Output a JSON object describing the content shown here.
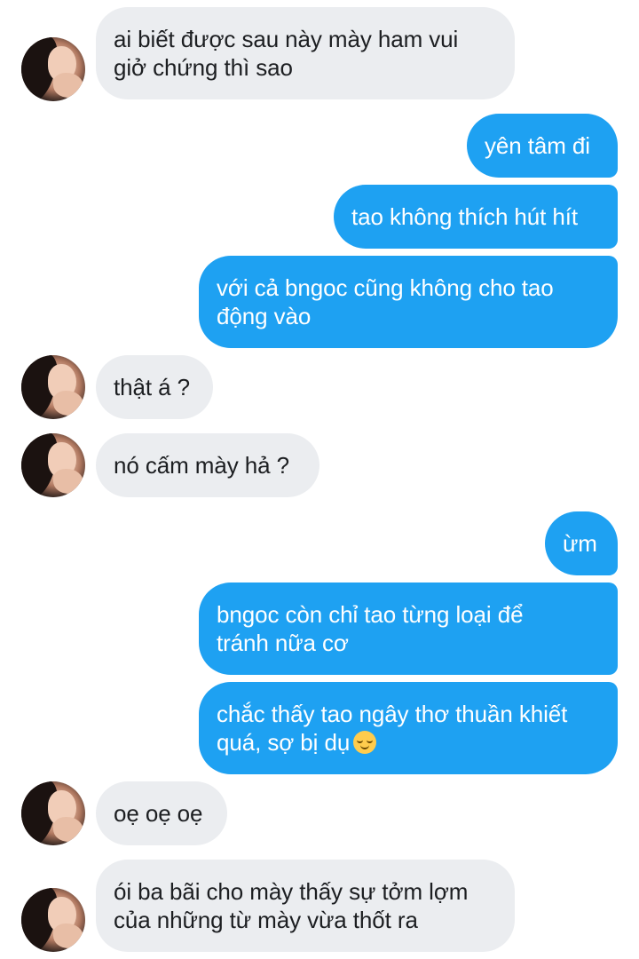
{
  "messages": [
    {
      "side": "in",
      "lines": [
        "ai biết được sau này mày ham vui",
        "giở chứng thì sao"
      ]
    },
    {
      "side": "out",
      "lines": [
        "yên tâm đi"
      ]
    },
    {
      "side": "out",
      "lines": [
        "tao không thích hút hít"
      ]
    },
    {
      "side": "out",
      "lines": [
        "với cả bngoc cũng không cho tao",
        "động vào"
      ]
    },
    {
      "side": "in",
      "lines": [
        "thật á ?"
      ]
    },
    {
      "side": "in",
      "lines": [
        "nó cấm mày hả ?"
      ]
    },
    {
      "side": "out",
      "lines": [
        "ừm"
      ]
    },
    {
      "side": "out",
      "lines": [
        "bngoc còn chỉ tao từng loại để",
        "tránh nữa cơ"
      ]
    },
    {
      "side": "out",
      "lines": [
        "chắc thấy tao ngây thơ thuần khiết",
        "quá, sợ bị dụ"
      ],
      "emoji": "relieved-face-emoji"
    },
    {
      "side": "in",
      "lines": [
        "oẹ oẹ oẹ"
      ]
    },
    {
      "side": "in",
      "lines": [
        "ói ba bãi cho mày thấy sự tởm lợm",
        "của những từ mày vừa thốt ra"
      ]
    }
  ],
  "colors": {
    "incoming_bubble": "#ebedf0",
    "outgoing_bubble": "#1ea1f2",
    "incoming_text": "#1c1e21",
    "outgoing_text": "#ffffff"
  }
}
